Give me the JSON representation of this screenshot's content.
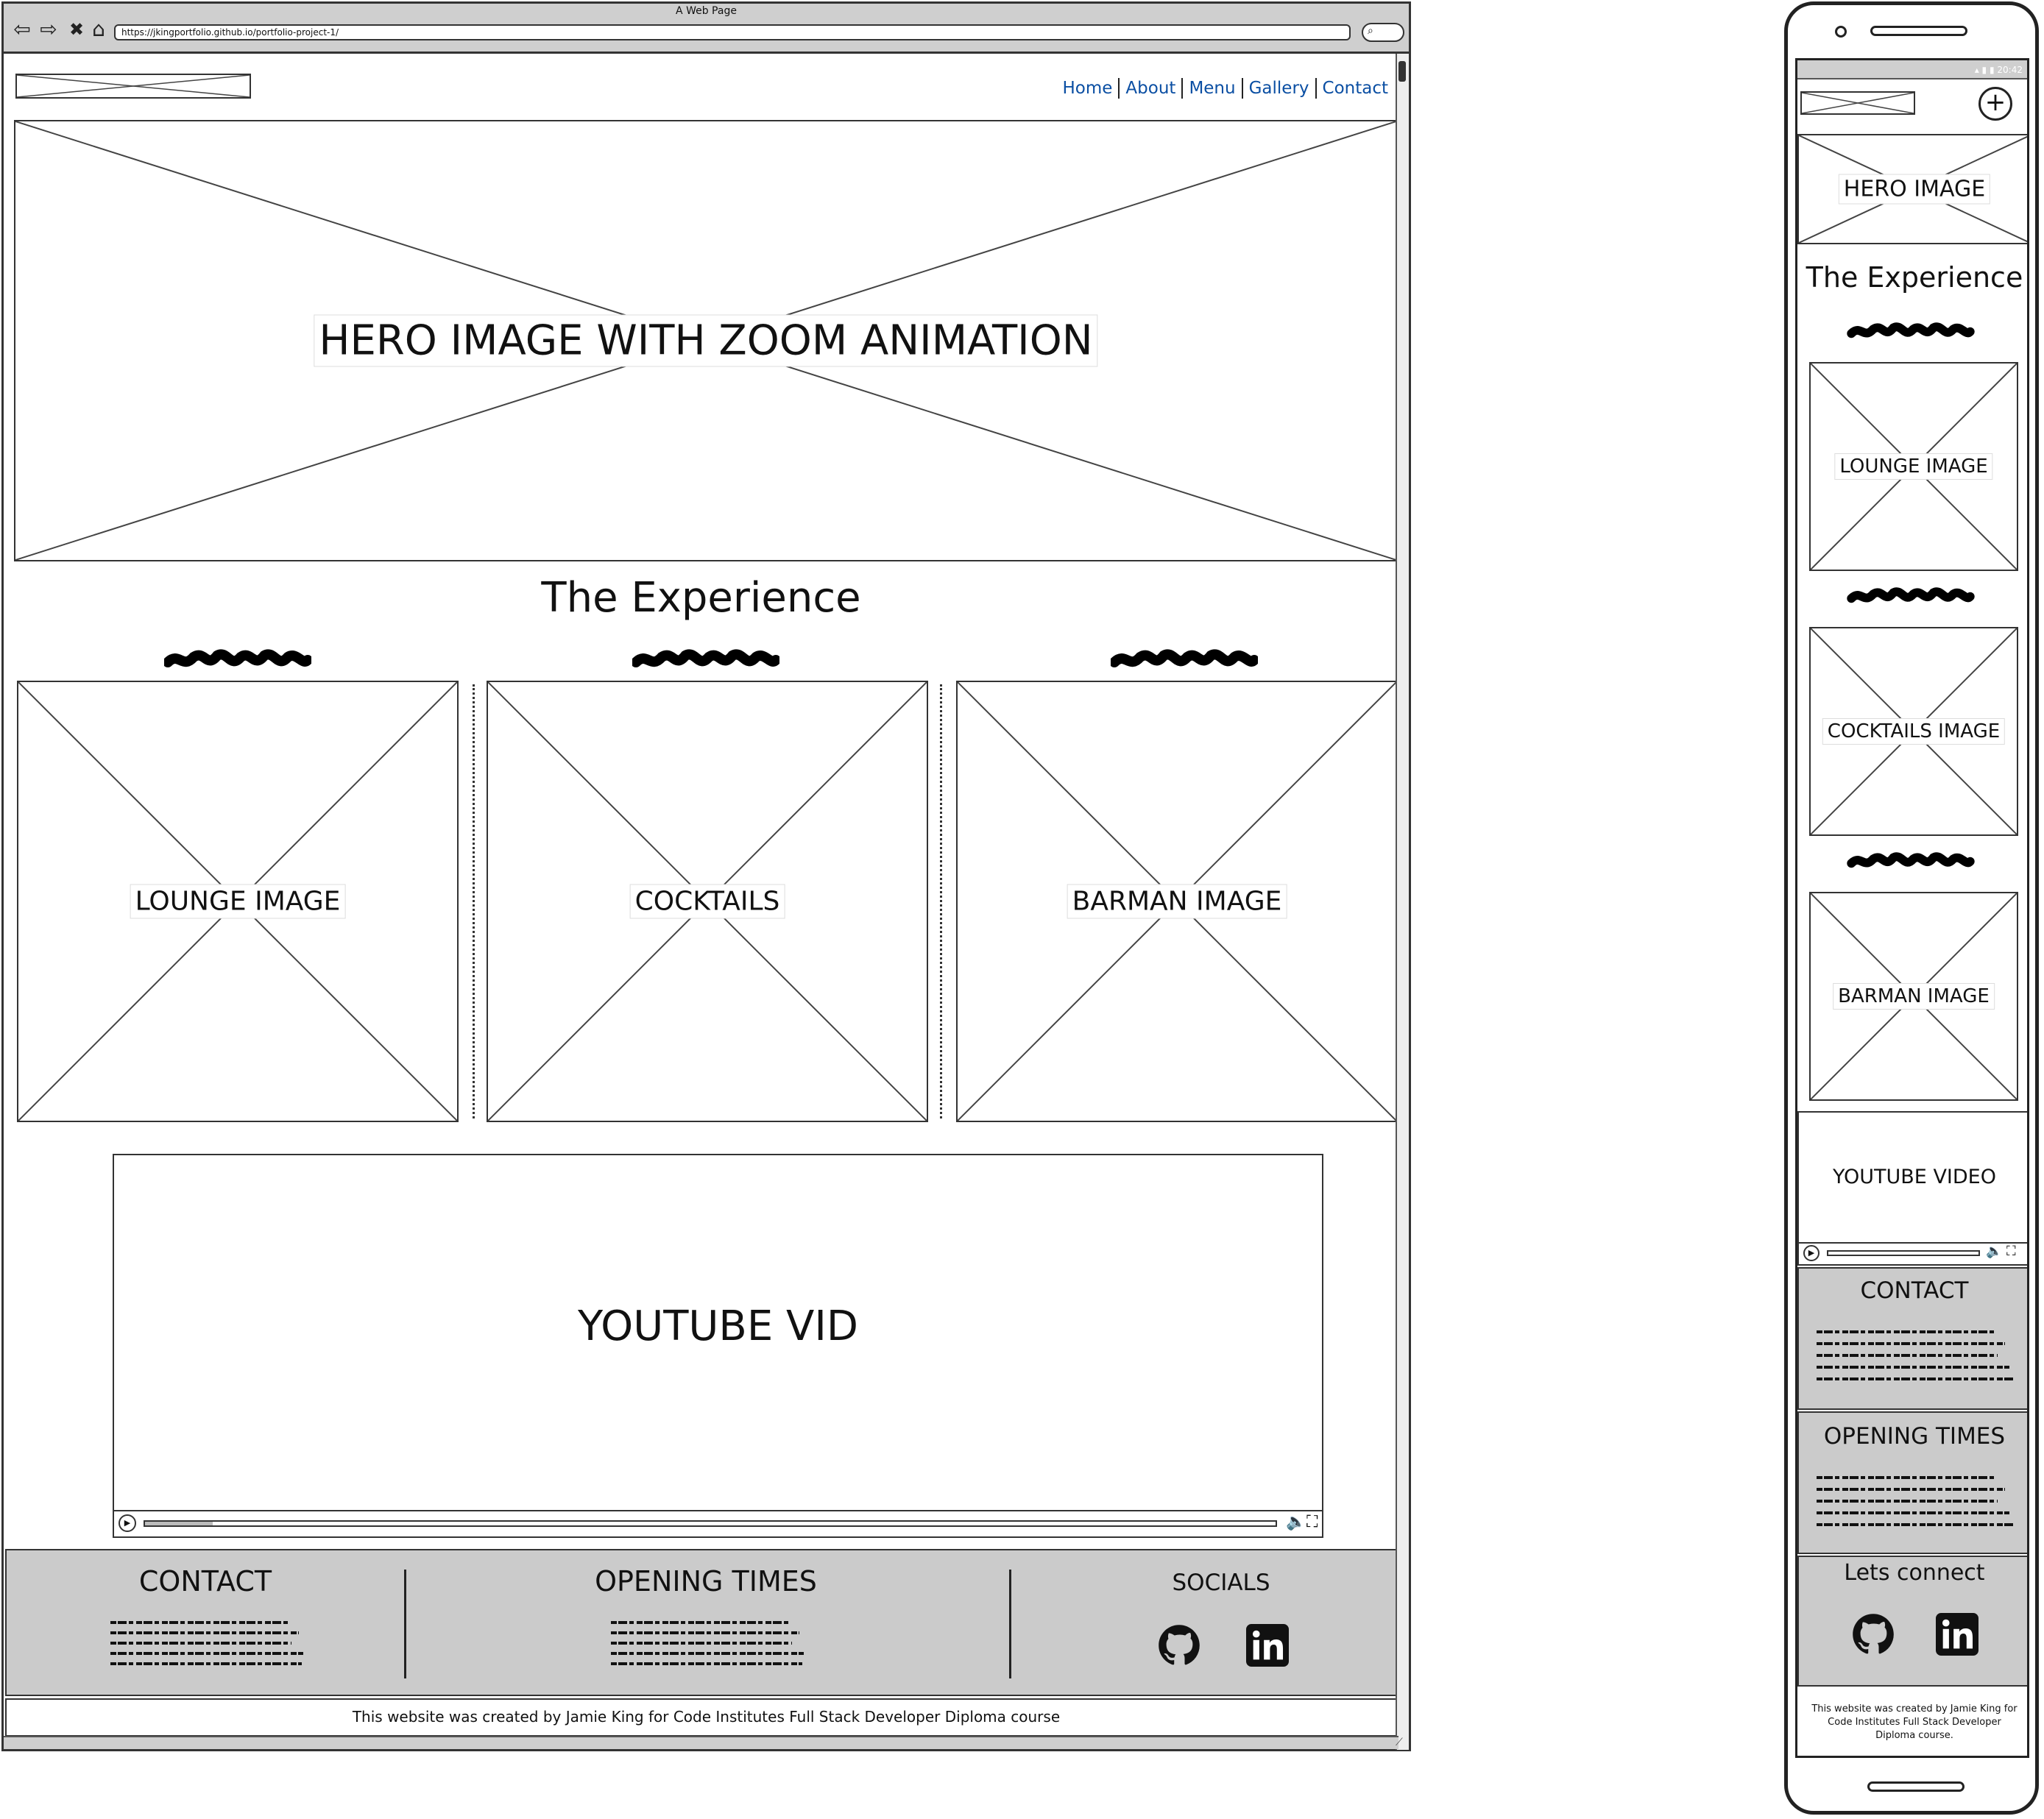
{
  "desktop": {
    "window_title": "A Web Page",
    "url": "https://jkingportfolio.github.io/portfolio-project-1/",
    "nav": [
      "Home",
      "About",
      "Menu",
      "Gallery",
      "Contact"
    ],
    "hero_label": "HERO IMAGE WITH ZOOM ANIMATION",
    "section_title": "The Experience",
    "cards": [
      "LOUNGE IMAGE",
      "COCKTAILS",
      "BARMAN IMAGE"
    ],
    "video_label": "YOUTUBE VID",
    "footer": {
      "contact_heading": "CONTACT",
      "opening_heading": "OPENING TIMES",
      "socials_heading": "SOCIALS"
    },
    "credit": "This website was created by Jamie King for Code Institutes Full Stack Developer Diploma course"
  },
  "mobile": {
    "status_time": "20:42",
    "hero_label": "HERO IMAGE",
    "section_title": "The Experience",
    "cards": [
      "LOUNGE IMAGE",
      "COCKTAILS IMAGE",
      "BARMAN IMAGE"
    ],
    "video_label": "YOUTUBE VIDEO",
    "contact_heading": "CONTACT",
    "opening_heading": "OPENING TIMES",
    "connect_heading": "Lets connect",
    "credit": "This website was created by Jamie King for Code Institutes Full Stack Developer Diploma course."
  },
  "icons": [
    "back-icon",
    "forward-icon",
    "close-icon",
    "home-icon",
    "search-icon",
    "play-icon",
    "volume-icon",
    "fullscreen-icon",
    "github-icon",
    "linkedin-icon",
    "plus-icon"
  ],
  "colors": {
    "link": "#0b4fa3",
    "footer_bg": "#cbcbcb",
    "frame": "#333333"
  }
}
